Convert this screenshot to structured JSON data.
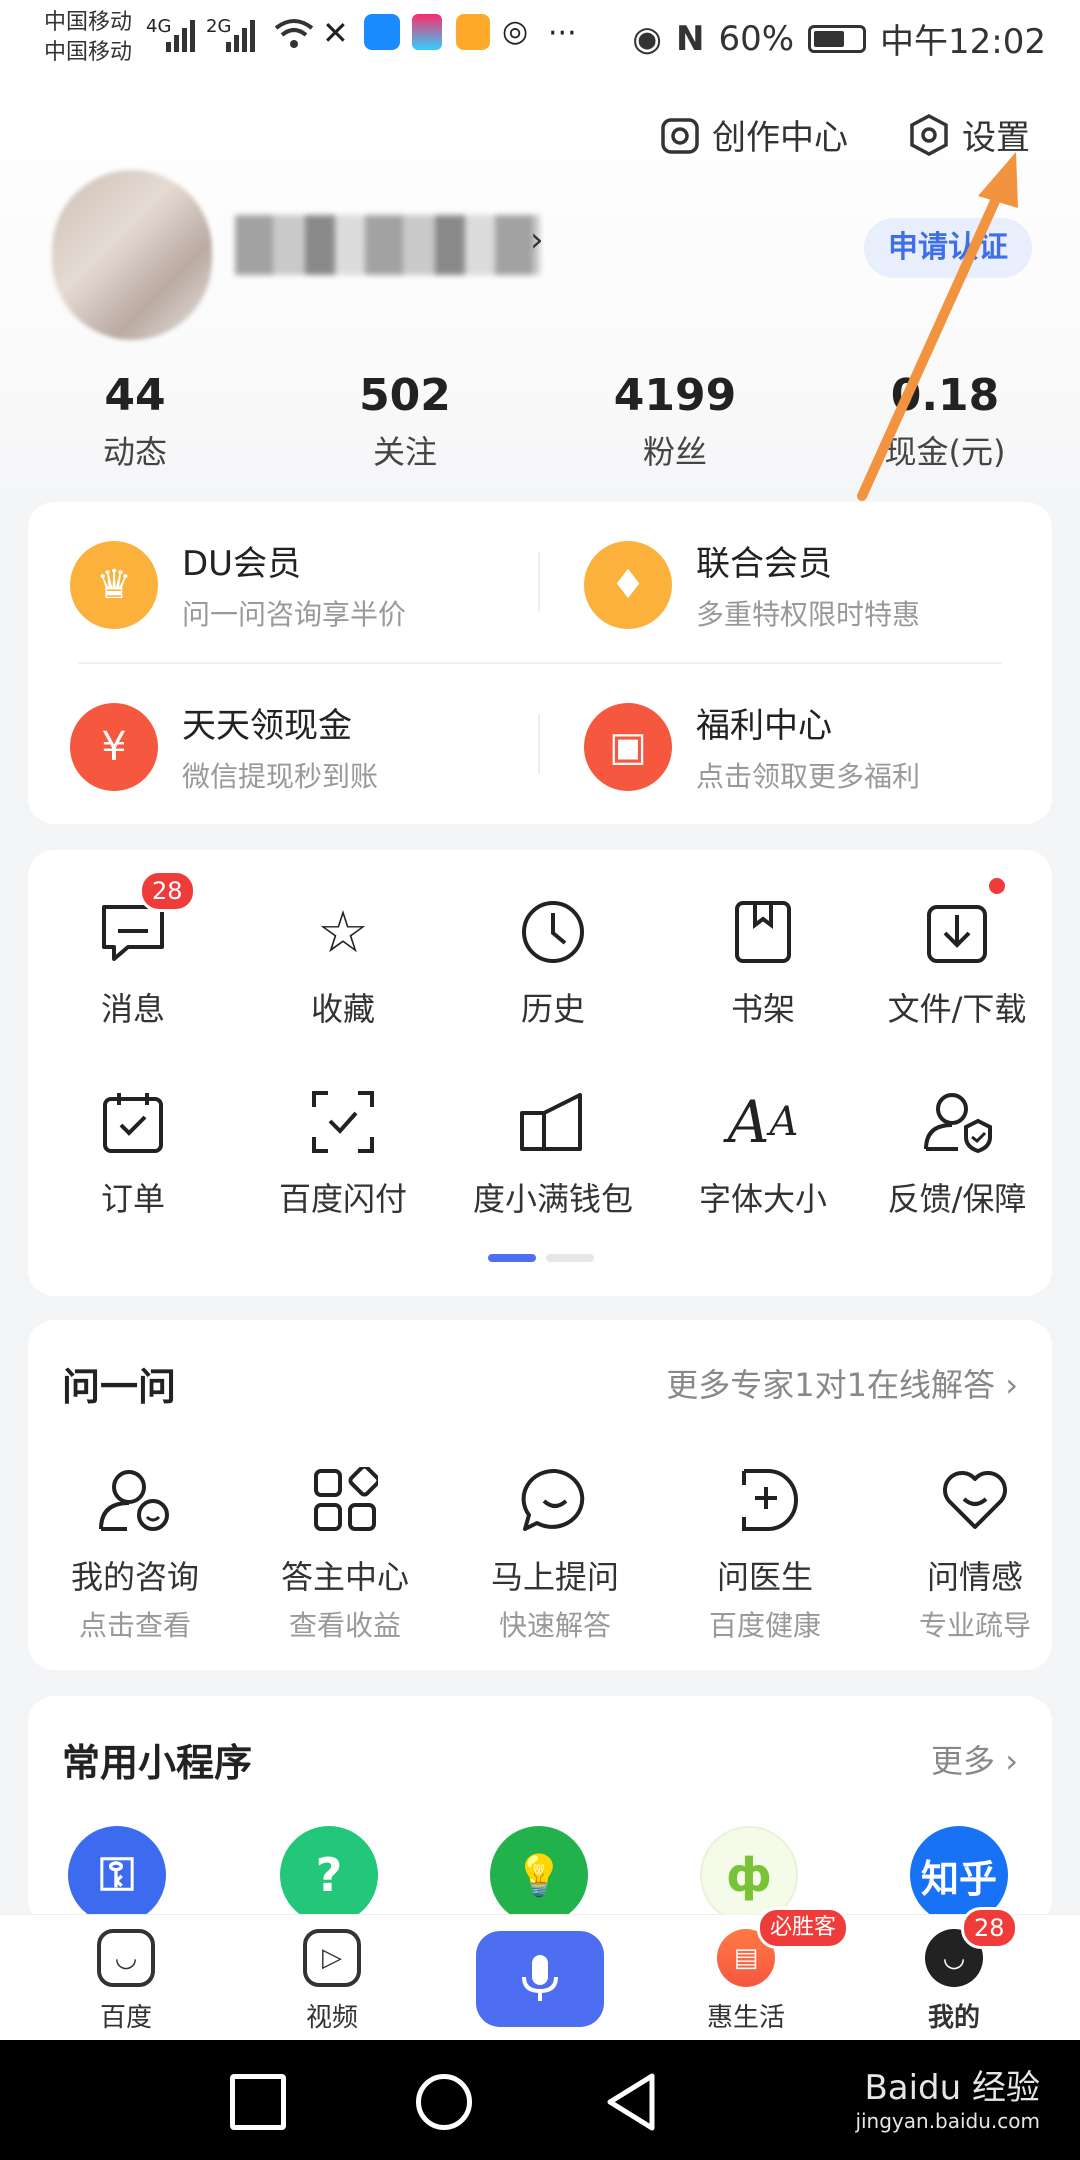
{
  "status_bar": {
    "carrier_1": "中国移动",
    "carrier_2": "中国移动",
    "net_1": "4G",
    "net_2": "2G",
    "more": "···",
    "battery": "60%",
    "time": "中午12:02"
  },
  "header": {
    "creation_center": "创作中心",
    "settings": "设置",
    "verify_button": "申请认证",
    "stats": [
      {
        "value": "44",
        "label": "动态"
      },
      {
        "value": "502",
        "label": "关注"
      },
      {
        "value": "4199",
        "label": "粉丝"
      },
      {
        "value": "0.18",
        "label": "现金(元)"
      }
    ]
  },
  "membership": [
    {
      "title": "DU会员",
      "subtitle": "问一问咨询享半价",
      "icon": "crown-icon",
      "color": "#fbb13c"
    },
    {
      "title": "联合会员",
      "subtitle": "多重特权限时特惠",
      "icon": "badge-icon",
      "color": "#fbb13c"
    },
    {
      "title": "天天领现金",
      "subtitle": "微信提现秒到账",
      "icon": "cash-icon",
      "color": "#f5573f"
    },
    {
      "title": "福利中心",
      "subtitle": "点击领取更多福利",
      "icon": "gift-icon",
      "color": "#f5573f"
    }
  ],
  "functions": [
    {
      "label": "消息",
      "icon": "message-icon",
      "badge": "28"
    },
    {
      "label": "收藏",
      "icon": "star-icon"
    },
    {
      "label": "历史",
      "icon": "clock-icon"
    },
    {
      "label": "书架",
      "icon": "bookshelf-icon"
    },
    {
      "label": "文件/下载",
      "icon": "download-icon"
    },
    {
      "label": "订单",
      "icon": "order-icon"
    },
    {
      "label": "百度闪付",
      "icon": "scan-pay-icon"
    },
    {
      "label": "度小满钱包",
      "icon": "wallet-icon"
    },
    {
      "label": "字体大小",
      "icon": "font-size-icon"
    },
    {
      "label": "反馈/保障",
      "icon": "feedback-icon"
    }
  ],
  "ask": {
    "title": "问一问",
    "more": "更多专家1对1在线解答 ›",
    "items": [
      {
        "label": "我的咨询",
        "sub": "点击查看",
        "icon": "consult-icon"
      },
      {
        "label": "答主中心",
        "sub": "查看收益",
        "icon": "grid-icon"
      },
      {
        "label": "马上提问",
        "sub": "快速解答",
        "icon": "chat-bubble-icon"
      },
      {
        "label": "问医生",
        "sub": "百度健康",
        "icon": "medical-icon"
      },
      {
        "label": "问情感",
        "sub": "专业疏导",
        "icon": "heart-icon"
      }
    ]
  },
  "mini_programs": {
    "title": "常用小程序",
    "more": "更多 ›",
    "items": [
      {
        "icon": "mini-app-1-icon",
        "glyph": "⚿",
        "color": "#3d6bf0"
      },
      {
        "icon": "question-icon",
        "glyph": "?",
        "color": "#22c77a"
      },
      {
        "icon": "lightbulb-icon",
        "glyph": "💡",
        "color": "#22b24c"
      },
      {
        "icon": "mini-app-4-icon",
        "glyph": "ф",
        "color": "#7ac236"
      },
      {
        "icon": "zhihu-icon",
        "glyph": "知乎",
        "color": "#1772f6"
      }
    ]
  },
  "bottom_nav": {
    "items": [
      {
        "label": "百度",
        "icon": "baidu-home-icon"
      },
      {
        "label": "视频",
        "icon": "video-icon"
      },
      {
        "label": "惠生活",
        "icon": "shopping-bag-icon",
        "badge": "必胜客"
      },
      {
        "label": "我的",
        "icon": "profile-face-icon",
        "badge": "28"
      }
    ]
  },
  "watermark": {
    "brand": "Baidu 经验",
    "url": "jingyan.baidu.com"
  }
}
